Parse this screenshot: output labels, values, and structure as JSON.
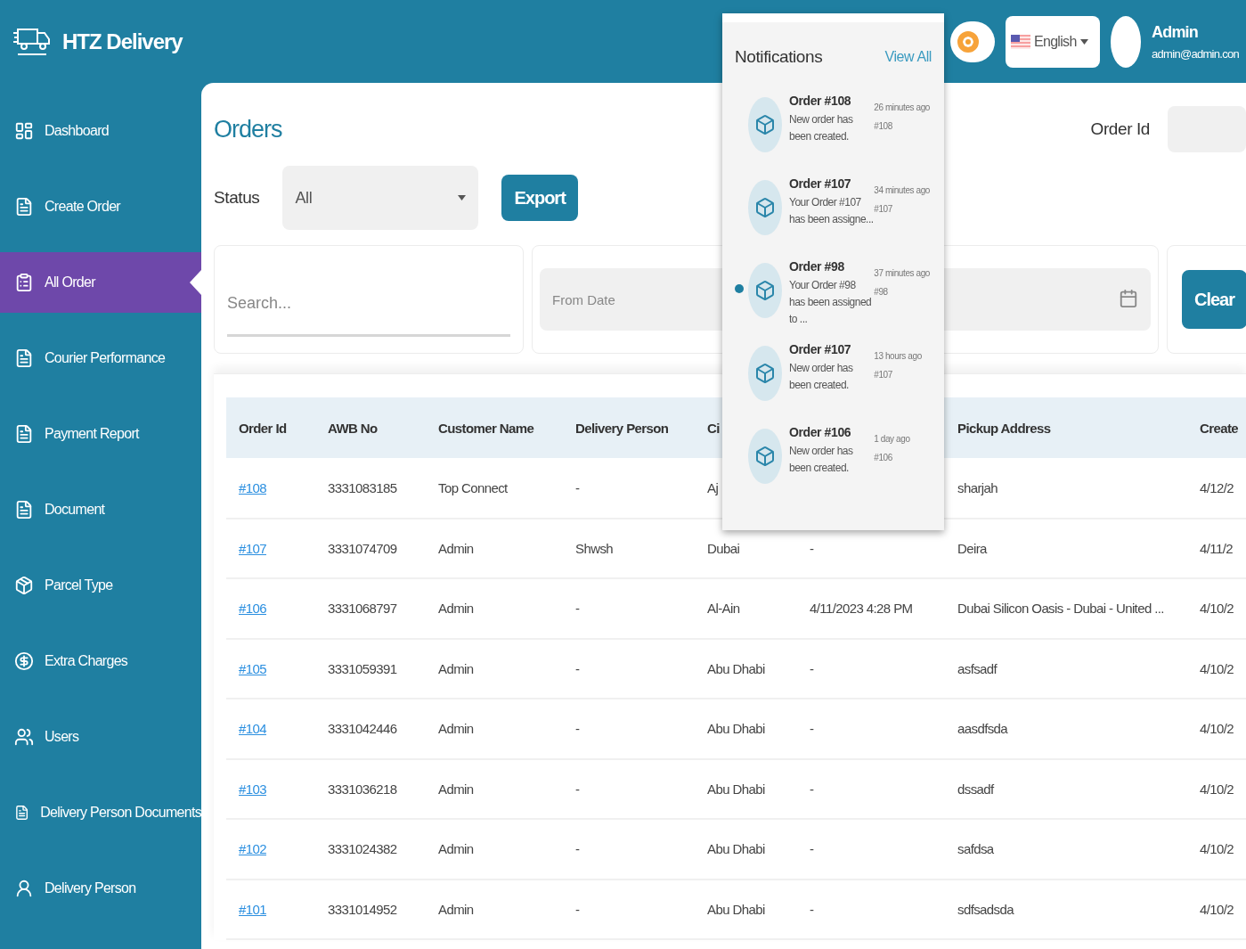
{
  "brand": "HTZ Delivery",
  "header": {
    "theme_toggle": {
      "on": false
    },
    "language": "English",
    "user": {
      "name": "Admin",
      "email": "admin@admin.con"
    }
  },
  "sidebar": {
    "items": [
      {
        "label": "Dashboard",
        "selected": false
      },
      {
        "label": "Create Order",
        "selected": false
      },
      {
        "label": "All Order",
        "selected": true
      },
      {
        "label": "Courier Performance",
        "selected": false
      },
      {
        "label": "Payment Report",
        "selected": false
      },
      {
        "label": "Document",
        "selected": false
      },
      {
        "label": "Parcel Type",
        "selected": false
      },
      {
        "label": "Extra Charges",
        "selected": false
      },
      {
        "label": "Users",
        "selected": false
      },
      {
        "label": "Delivery Person Documents",
        "selected": false
      },
      {
        "label": "Delivery Person",
        "selected": false
      }
    ]
  },
  "page": {
    "title": "Orders",
    "order_id_label": "Order Id",
    "status_label": "Status",
    "status_value": "All",
    "export_button": "Export",
    "search_placeholder": "Search...",
    "date_placeholder": "From Date",
    "clear_button": "Clear"
  },
  "table": {
    "columns": [
      "Order Id",
      "AWB No",
      "Customer Name",
      "Delivery Person",
      "Ci",
      null,
      "Pickup Address",
      "Create"
    ],
    "rows": [
      [
        "#108",
        "3331083185",
        "Top Connect",
        "-",
        "Aj",
        null,
        "sharjah",
        "4/12/2"
      ],
      [
        "#107",
        "3331074709",
        "Admin",
        "Shwsh",
        "Dubai",
        "-",
        "Deira",
        "4/11/2"
      ],
      [
        "#106",
        "3331068797",
        "Admin",
        "-",
        "Al-Ain",
        "4/11/2023 4:28 PM",
        "Dubai Silicon Oasis - Dubai - United ...",
        "4/10/2"
      ],
      [
        "#105",
        "3331059391",
        "Admin",
        "-",
        "Abu Dhabi",
        "-",
        "asfsadf",
        "4/10/2"
      ],
      [
        "#104",
        "3331042446",
        "Admin",
        "-",
        "Abu Dhabi",
        "-",
        "aasdfsda",
        "4/10/2"
      ],
      [
        "#103",
        "3331036218",
        "Admin",
        "-",
        "Abu Dhabi",
        "-",
        "dssadf",
        "4/10/2"
      ],
      [
        "#102",
        "3331024382",
        "Admin",
        "-",
        "Abu Dhabi",
        "-",
        "safdsa",
        "4/10/2"
      ],
      [
        "#101",
        "3331014952",
        "Admin",
        "-",
        "Abu Dhabi",
        "-",
        "sdfsadsda",
        "4/10/2"
      ]
    ]
  },
  "notifications": {
    "title": "Notifications",
    "view_all": "View All",
    "items": [
      {
        "title": "Order #108",
        "body": "New order has been created.",
        "time": "26 minutes ago",
        "ref": "#108",
        "unread": false
      },
      {
        "title": "Order #107",
        "body": "Your Order #107 has been assigne...",
        "time": "34 minutes ago",
        "ref": "#107",
        "unread": false
      },
      {
        "title": "Order #98",
        "body": "Your Order #98 has been assigned to ...",
        "time": "37 minutes ago",
        "ref": "#98",
        "unread": true
      },
      {
        "title": "Order #107",
        "body": "New order has been created.",
        "time": "13 hours ago",
        "ref": "#107",
        "unread": false
      },
      {
        "title": "Order #106",
        "body": "New order has been created.",
        "time": "1 day ago",
        "ref": "#106",
        "unread": false
      }
    ]
  }
}
